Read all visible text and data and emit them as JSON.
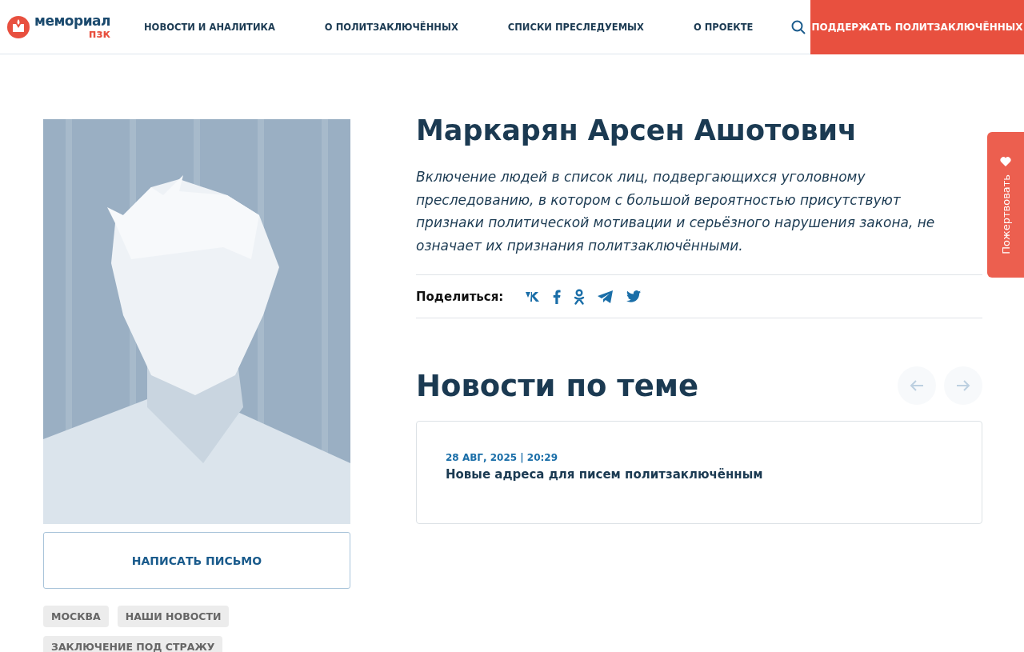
{
  "header": {
    "logo": {
      "top": "мемориал",
      "bottom": "пзк"
    },
    "nav": [
      {
        "label": "НОВОСТИ И АНАЛИТИКА"
      },
      {
        "label": "О ПОЛИТЗАКЛЮЧЁННЫХ"
      },
      {
        "label": "СПИСКИ ПРЕСЛЕДУЕМЫХ"
      },
      {
        "label": "О ПРОЕКТЕ"
      }
    ],
    "support_button": "ПОДДЕРЖАТЬ ПОЛИТЗАКЛЮЧЁННЫХ"
  },
  "profile": {
    "write_button": "НАПИСАТЬ ПИСЬМО",
    "tags": [
      "МОСКВА",
      "НАШИ НОВОСТИ",
      "ЗАКЛЮЧЕНИЕ ПОД СТРАЖУ"
    ]
  },
  "person": {
    "name": "Маркарян Арсен Ашотович",
    "disclaimer": "Включение людей в список лиц, подвергающихся уголовному преследованию, в котором с большой вероятностью присутствуют признаки политической мотивации и серьёзного нарушения закона, не означает их признания политзаключёнными.",
    "share_label": "Поделиться:",
    "share": [
      {
        "kind": "vk"
      },
      {
        "kind": "facebook"
      },
      {
        "kind": "ok"
      },
      {
        "kind": "telegram"
      },
      {
        "kind": "twitter"
      }
    ]
  },
  "related": {
    "title": "Новости по теме",
    "news": [
      {
        "date": "28 АВГ, 2025 | 20:29",
        "title": "Новые адреса для писем политзаключённым"
      }
    ]
  },
  "side_tab": "Пожертвовать"
}
